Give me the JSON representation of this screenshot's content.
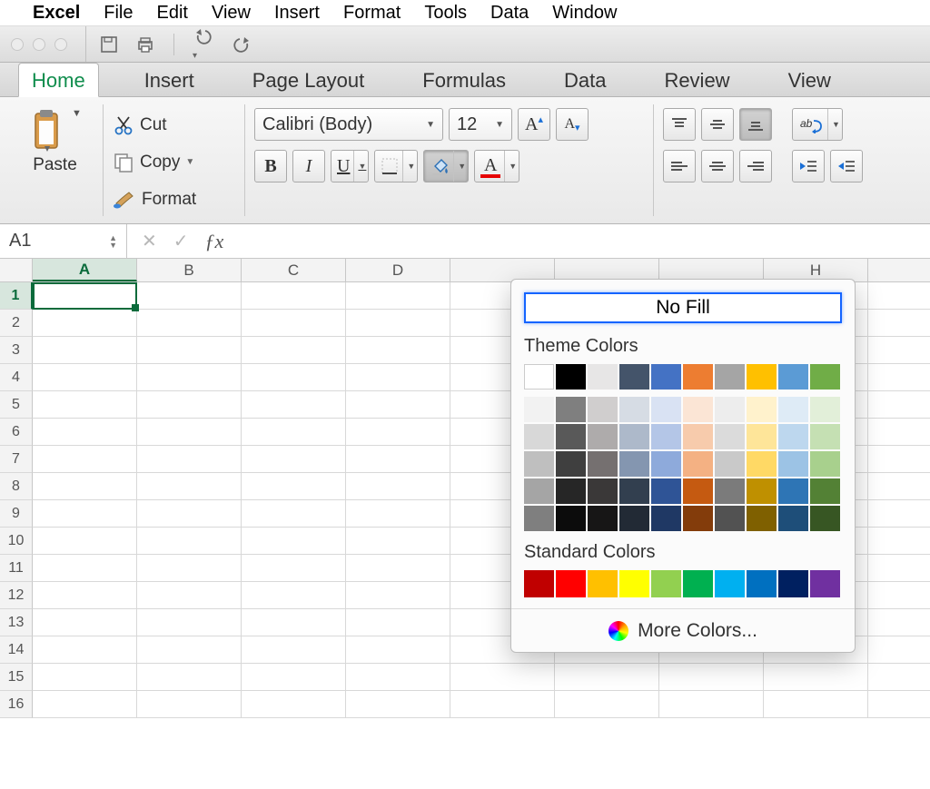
{
  "menubar": {
    "app": "Excel",
    "items": [
      "File",
      "Edit",
      "View",
      "Insert",
      "Format",
      "Tools",
      "Data",
      "Window"
    ]
  },
  "ribbonTabs": [
    {
      "label": "Home",
      "active": true
    },
    {
      "label": "Insert",
      "active": false
    },
    {
      "label": "Page Layout",
      "active": false
    },
    {
      "label": "Formulas",
      "active": false
    },
    {
      "label": "Data",
      "active": false
    },
    {
      "label": "Review",
      "active": false
    },
    {
      "label": "View",
      "active": false
    }
  ],
  "clipboard": {
    "paste": "Paste",
    "cut": "Cut",
    "copy": "Copy",
    "format": "Format"
  },
  "font": {
    "name": "Calibri (Body)",
    "size": "12"
  },
  "namebox": "A1",
  "columns": [
    "A",
    "B",
    "C",
    "D",
    "",
    "",
    "",
    "H"
  ],
  "rowCount": 16,
  "selectedCol": 0,
  "selectedRow": 0,
  "popover": {
    "noFill": "No Fill",
    "themeHeader": "Theme Colors",
    "themeTop": [
      "#ffffff",
      "#000000",
      "#e7e6e6",
      "#44546a",
      "#4472c4",
      "#ed7d31",
      "#a5a5a5",
      "#ffc000",
      "#5b9bd5",
      "#70ad47"
    ],
    "themeShades": [
      [
        "#f2f2f2",
        "#7f7f7f",
        "#d0cece",
        "#d6dce4",
        "#d9e2f3",
        "#fbe5d5",
        "#ededed",
        "#fff2cc",
        "#deebf6",
        "#e2efd9"
      ],
      [
        "#d8d8d8",
        "#595959",
        "#aeabab",
        "#adb9ca",
        "#b4c6e7",
        "#f7cbac",
        "#dbdbdb",
        "#fee599",
        "#bdd7ee",
        "#c5e0b3"
      ],
      [
        "#bfbfbf",
        "#3f3f3f",
        "#757070",
        "#8496b0",
        "#8eaadb",
        "#f4b183",
        "#c9c9c9",
        "#ffd965",
        "#9cc3e5",
        "#a8d08d"
      ],
      [
        "#a5a5a5",
        "#262626",
        "#3a3838",
        "#323f4f",
        "#2f5496",
        "#c55a11",
        "#7b7b7b",
        "#bf9000",
        "#2e75b5",
        "#538135"
      ],
      [
        "#7f7f7f",
        "#0c0c0c",
        "#171616",
        "#222a35",
        "#1f3864",
        "#833c0b",
        "#525252",
        "#7f6000",
        "#1e4e79",
        "#375623"
      ]
    ],
    "standardHeader": "Standard Colors",
    "standard": [
      "#c00000",
      "#ff0000",
      "#ffc000",
      "#ffff00",
      "#92d050",
      "#00b050",
      "#00b0f0",
      "#0070c0",
      "#002060",
      "#7030a0"
    ],
    "more": "More Colors..."
  }
}
